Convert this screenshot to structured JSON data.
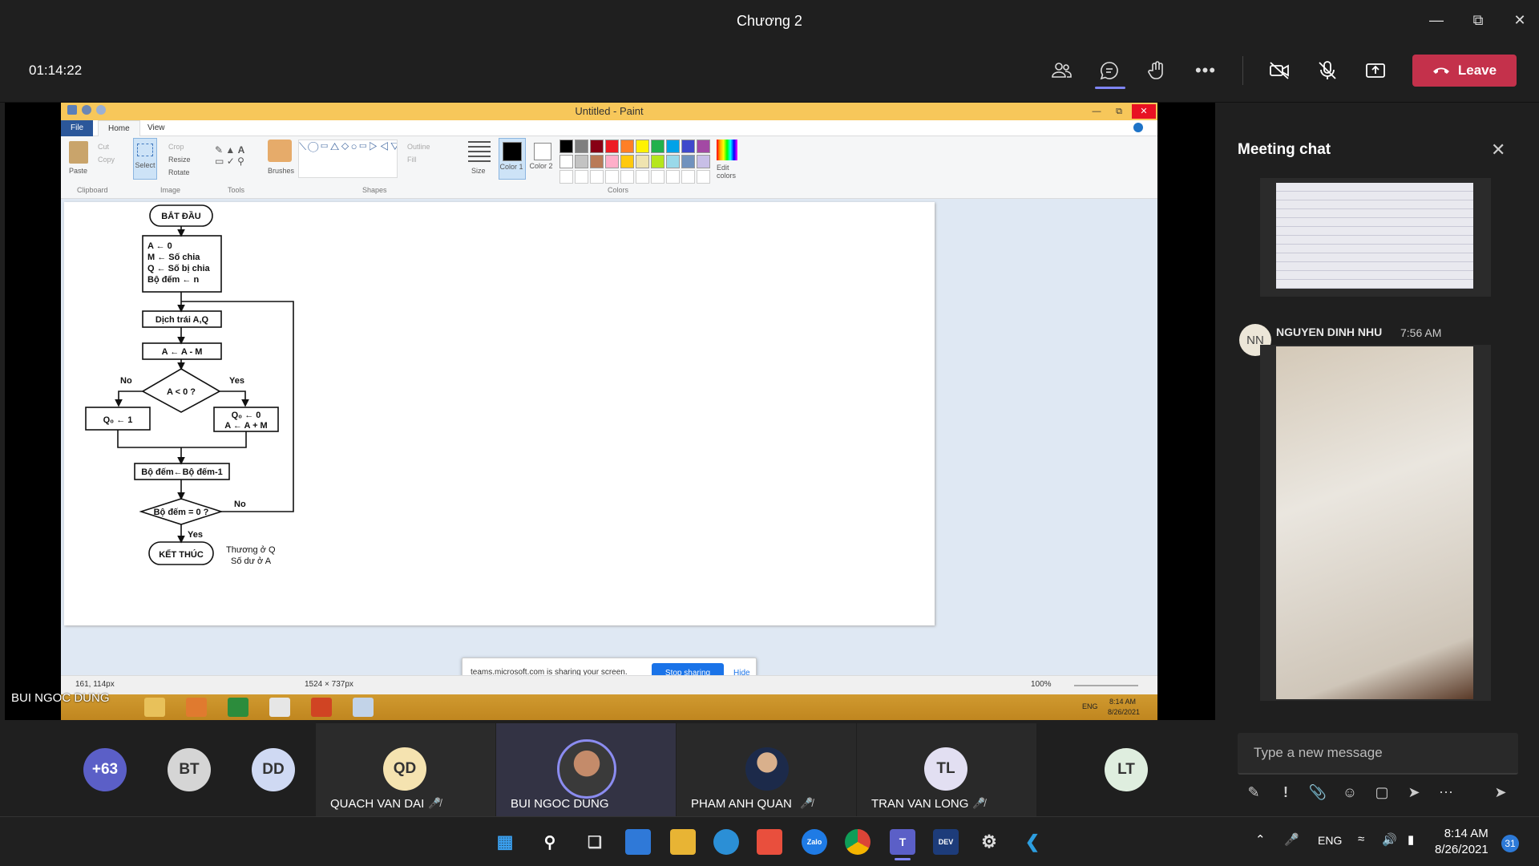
{
  "window": {
    "title": "Chương 2"
  },
  "meeting": {
    "timer": "01:14:22",
    "leave_label": "Leave"
  },
  "paint": {
    "title": "Untitled - Paint",
    "tabs": [
      "File",
      "Home",
      "View"
    ],
    "ribbon": {
      "paste": "Paste",
      "cut": "Cut",
      "copy": "Copy",
      "clipboard": "Clipboard",
      "select": "Select",
      "crop": "Crop",
      "resize": "Resize",
      "rotate": "Rotate",
      "image": "Image",
      "tools": "Tools",
      "brushes": "Brushes",
      "outline": "Outline",
      "fill": "Fill",
      "shapes": "Shapes",
      "size": "Size",
      "color1": "Color 1",
      "color2": "Color 2",
      "edit_colors": "Edit colors",
      "colors": "Colors"
    },
    "palette": [
      "#000000",
      "#7f7f7f",
      "#880015",
      "#ed1c24",
      "#ff7f27",
      "#fff200",
      "#22b14c",
      "#00a2e8",
      "#3f48cc",
      "#a349a4",
      "#ffffff",
      "#c3c3c3",
      "#b97a57",
      "#ffaec9",
      "#ffc90e",
      "#efe4b0",
      "#b5e61d",
      "#99d9ea",
      "#7092be",
      "#c8bfe7"
    ],
    "status": {
      "cursor": "161, 114px",
      "canvas_size": "1524 × 737px",
      "zoom": "100%"
    },
    "mini_taskbar": {
      "lang": "ENG",
      "time": "8:14 AM",
      "date": "8/26/2021"
    }
  },
  "flowchart": {
    "start": "BẮT ĐẦU",
    "init": [
      "A ← 0",
      "M ← Số chia",
      "Q ← Số bị chia",
      "Bộ đếm ← n"
    ],
    "shift": "Dịch trái A,Q",
    "sub": "A ← A - M",
    "cond1": "A < 0 ?",
    "no1": "No",
    "yes1": "Yes",
    "left_box": "Q₀ ← 1",
    "right_box": [
      "Q₀ ← 0",
      "A ← A + M"
    ],
    "dec": "Bộ đếm←Bộ đếm-1",
    "cond2": "Bộ đếm = 0 ?",
    "no2": "No",
    "yes2": "Yes",
    "end": "KẾT THÚC",
    "note": [
      "Thương ở Q",
      "Số dư ở A"
    ]
  },
  "share_bar": {
    "message": "teams.microsoft.com is sharing your screen.",
    "stop": "Stop sharing",
    "hide": "Hide"
  },
  "presenter_label": "BUI NGOC DUNG",
  "participants": [
    {
      "initials": "+63",
      "name": ""
    },
    {
      "initials": "BT",
      "name": ""
    },
    {
      "initials": "DD",
      "name": ""
    },
    {
      "initials": "QD",
      "name": "QUACH VAN DAI"
    },
    {
      "initials": "",
      "name": "BUI NGOC DUNG"
    },
    {
      "initials": "",
      "name": "PHAM ANH QUAN"
    },
    {
      "initials": "TL",
      "name": "TRAN VAN LONG"
    },
    {
      "initials": "LT",
      "name": ""
    }
  ],
  "chat": {
    "title": "Meeting chat",
    "sender_initials": "NN",
    "sender": "NGUYEN DINH NHU",
    "time": "7:56 AM",
    "compose_placeholder": "Type a new message"
  },
  "taskbar": {
    "lang": "ENG",
    "time": "8:14 AM",
    "date": "8/26/2021",
    "notifications": "31"
  }
}
